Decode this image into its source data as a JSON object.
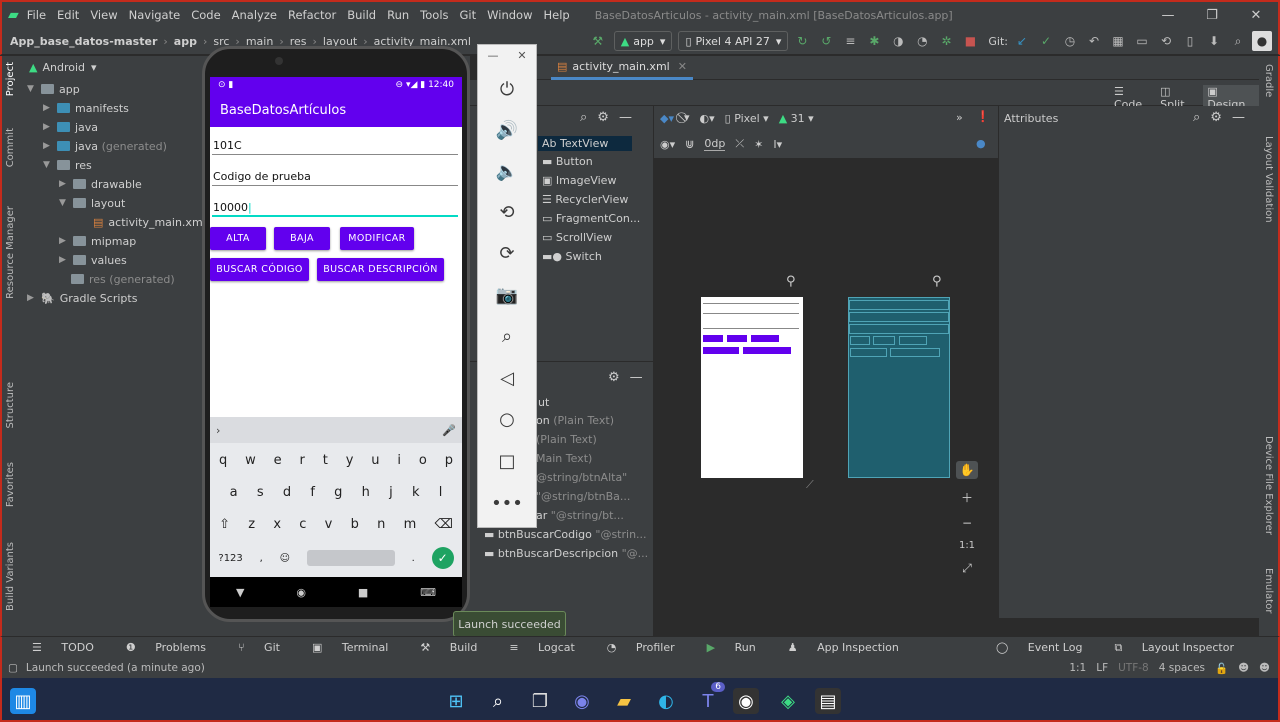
{
  "window": {
    "menu": [
      "File",
      "Edit",
      "View",
      "Navigate",
      "Code",
      "Analyze",
      "Refactor",
      "Build",
      "Run",
      "Tools",
      "Git",
      "Window",
      "Help"
    ],
    "title": "BaseDatosArticulos - activity_main.xml [BaseDatosArticulos.app]",
    "minimize": "—",
    "maximize": "❐",
    "close": "✕"
  },
  "breadcrumb": [
    "App_base_datos-master",
    "app",
    "src",
    "main",
    "res",
    "layout",
    "activity_main.xml"
  ],
  "toolbar": {
    "run_config": "app",
    "device": "Pixel 4 API 27",
    "git_label": "Git:"
  },
  "project_panel": {
    "view_mode": "Android",
    "tree": [
      {
        "label": "app",
        "indent": 0
      },
      {
        "label": "manifests",
        "indent": 1
      },
      {
        "label": "java",
        "indent": 1
      },
      {
        "label": "java",
        "extra": "(generated)",
        "indent": 1
      },
      {
        "label": "res",
        "indent": 1
      },
      {
        "label": "drawable",
        "indent": 2
      },
      {
        "label": "layout",
        "indent": 2
      },
      {
        "label": "activity_main.xml",
        "indent": 3
      },
      {
        "label": "mipmap",
        "indent": 2
      },
      {
        "label": "values",
        "indent": 2
      },
      {
        "label": "res",
        "extra": "(generated)",
        "indent": 1
      },
      {
        "label": "Gradle Scripts",
        "indent": 0
      }
    ]
  },
  "left_stripe": [
    "Project",
    "Commit",
    "Resource Manager",
    "Structure",
    "Favorites",
    "Build Variants"
  ],
  "right_stripe": [
    "Gradle",
    "Layout Validation",
    "Device File Explorer",
    "Emulator"
  ],
  "phone": {
    "status_time": "12:40",
    "app_title": "BaseDatosArtículos",
    "field_code": "101C",
    "field_desc": "Codigo de prueba",
    "field_price": "10000",
    "btn_alta": "ALTA",
    "btn_baja": "BAJA",
    "btn_modificar": "MODIFICAR",
    "btn_buscar_codigo": "BUSCAR CÓDIGO",
    "btn_buscar_desc": "BUSCAR DESCRIPCIÓN",
    "keyboard_rows": [
      [
        "q",
        "w",
        "e",
        "r",
        "t",
        "y",
        "u",
        "i",
        "o",
        "p"
      ],
      [
        "a",
        "s",
        "d",
        "f",
        "g",
        "h",
        "j",
        "k",
        "l"
      ],
      [
        "⇧",
        "z",
        "x",
        "c",
        "v",
        "b",
        "n",
        "m",
        "⌫"
      ],
      [
        "?123",
        ",",
        "☺",
        "",
        ".",
        "✓"
      ]
    ]
  },
  "editor": {
    "tab": "activity_main.xml",
    "modes": [
      "Code",
      "Split",
      "Design"
    ],
    "device_select": "Pixel",
    "api_select": "31",
    "margin": "0dp",
    "attributes_title": "Attributes"
  },
  "palette": {
    "items": [
      "Ab TextView",
      "Button",
      "ImageView",
      "RecyclerView",
      "FragmentCon...",
      "ScrollView",
      "Switch"
    ]
  },
  "component_tree": {
    "items": [
      {
        "name": "ut",
        "value": ""
      },
      {
        "name": "on",
        "value": "(Plain Text)"
      },
      {
        "name": "",
        "value": "(Plain Text)"
      },
      {
        "name": "",
        "value": "Main Text)"
      },
      {
        "name": "",
        "value": "@string/btnAlta\""
      },
      {
        "name": "",
        "value": "\"@string/btnBa..."
      },
      {
        "name": "ar",
        "value": "\"@string/bt..."
      },
      {
        "name": "btnBuscarCodigo",
        "value": "\"@strin..."
      },
      {
        "name": "btnBuscarDescripcion",
        "value": "\"@..."
      }
    ]
  },
  "tooltip": "Launch succeeded",
  "bottom_tabs": [
    "TODO",
    "Problems",
    "Git",
    "Terminal",
    "Build",
    "Logcat",
    "Profiler",
    "Run",
    "App Inspection"
  ],
  "bottom_right_tabs": [
    "Event Log",
    "Layout Inspector"
  ],
  "status": {
    "message": "Launch succeeded (a minute ago)",
    "position": "1:1",
    "line_sep": "LF",
    "encoding": "UTF-8",
    "indent": "4 spaces"
  },
  "taskbar": {
    "teams_badge": "6"
  }
}
